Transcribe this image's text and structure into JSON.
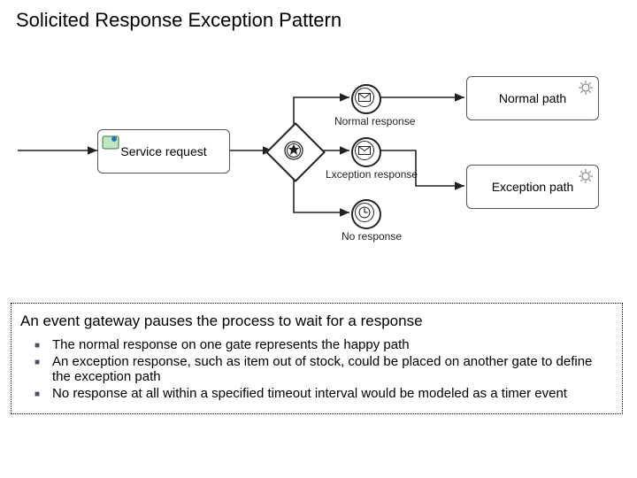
{
  "title": "Solicited Response Exception Pattern",
  "diagram": {
    "serviceTask": {
      "label": "Service request"
    },
    "normalTask": {
      "label": "Normal path"
    },
    "exceptionTask": {
      "label": "Exception path"
    },
    "events": {
      "normal": {
        "label": "Normal response"
      },
      "exception": {
        "label": "Lxception response"
      },
      "timer": {
        "label": "No response"
      }
    }
  },
  "caption": {
    "heading": "An event gateway pauses the process to wait for a response",
    "bullets": [
      "The normal response on one gate represents the happy path",
      "An exception response, such as item out of stock, could be placed on another gate to define the exception path",
      "No response at all within a specified timeout interval would be modeled as a timer event"
    ]
  }
}
